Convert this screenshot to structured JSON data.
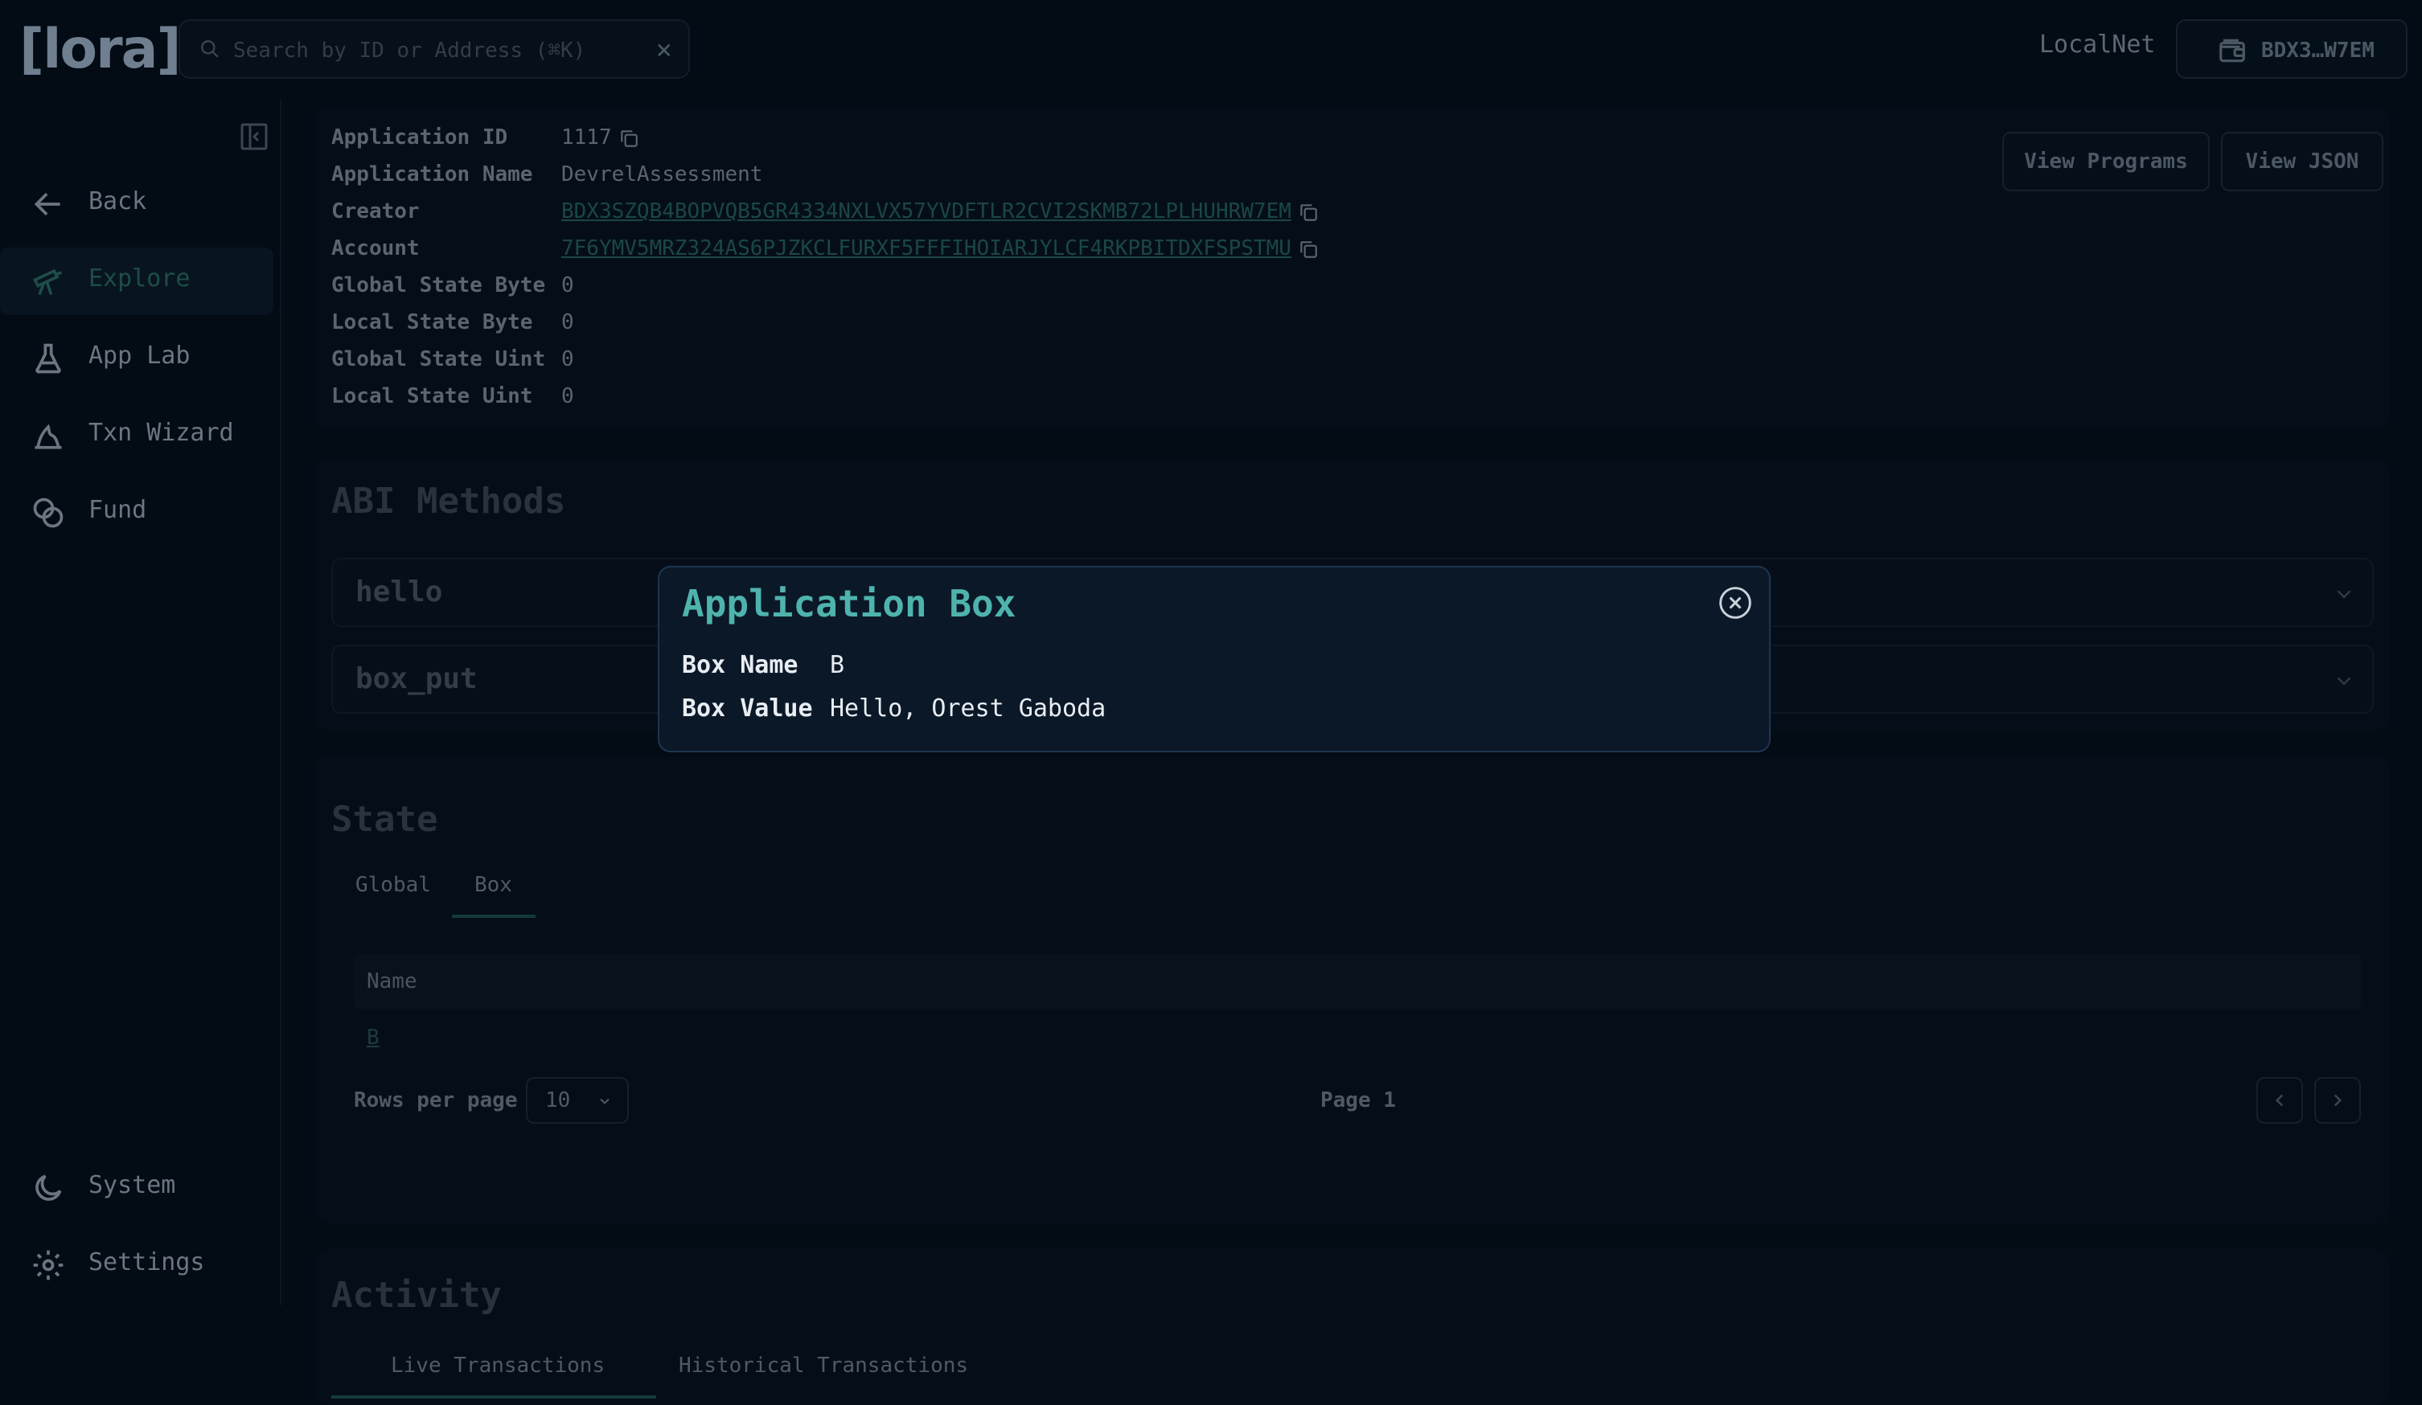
{
  "header": {
    "logo": "[lora]",
    "search_placeholder": "Search by ID or Address (⌘K)",
    "clear_glyph": "×",
    "network": "LocalNet",
    "wallet_address": "BDX3…W7EM"
  },
  "sidebar": {
    "items": [
      {
        "label": "Back",
        "icon": "arrow-left-icon"
      },
      {
        "label": "Explore",
        "icon": "telescope-icon",
        "active": true
      },
      {
        "label": "App Lab",
        "icon": "flask-icon"
      },
      {
        "label": "Txn Wizard",
        "icon": "wizard-hat-icon"
      },
      {
        "label": "Fund",
        "icon": "coins-icon"
      }
    ],
    "bottom_items": [
      {
        "label": "System",
        "icon": "moon-icon"
      },
      {
        "label": "Settings",
        "icon": "gear-icon"
      }
    ]
  },
  "app": {
    "properties": [
      {
        "key": "Application ID",
        "value": "1117"
      },
      {
        "key": "Application Name",
        "value": "DevrelAssessment"
      },
      {
        "key": "Creator",
        "value": "BDX3SZQB4BOPVQB5GR4334NXLVX57YVDFTLR2CVI2SKMB72LPLHUHRW7EM"
      },
      {
        "key": "Account",
        "value": "7F6YMV5MRZ324AS6PJZKCLFURXF5FFFIHOIARJYLCF4RKPBITDXFSPSTMU"
      },
      {
        "key": "Global State Byte",
        "value": "0"
      },
      {
        "key": "Local State Byte",
        "value": "0"
      },
      {
        "key": "Global State Uint",
        "value": "0"
      },
      {
        "key": "Local State Uint",
        "value": "0"
      }
    ],
    "view_programs_label": "View Programs",
    "view_json_label": "View JSON"
  },
  "abi": {
    "title": "ABI Methods",
    "methods": [
      "hello",
      "box_put"
    ]
  },
  "state": {
    "title": "State",
    "tabs": [
      "Global",
      "Box"
    ],
    "active_tab": "Box",
    "column_header": "Name",
    "rows": [
      "B"
    ],
    "rows_per_page_label": "Rows per page",
    "rows_per_page_value": "10",
    "page_label": "Page 1"
  },
  "activity": {
    "title": "Activity",
    "tabs": [
      "Live Transactions",
      "Historical Transactions"
    ]
  },
  "modal": {
    "title": "Application Box",
    "box_name_label": "Box Name",
    "box_name_value": "B",
    "box_value_label": "Box Value",
    "box_value_value": "Hello, Orest Gaboda"
  },
  "colors": {
    "accent": "#4fb3ad",
    "background": "#030b14",
    "modal_bg": "#0b1828"
  }
}
